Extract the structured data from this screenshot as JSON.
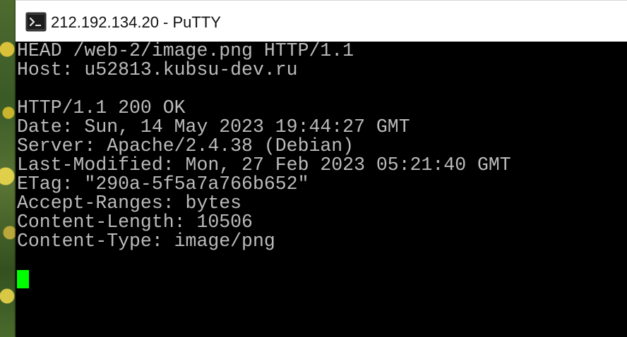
{
  "window": {
    "title": "212.192.134.20 - PuTTY",
    "icon": "putty-terminal-icon"
  },
  "terminal": {
    "lines": [
      "HEAD /web-2/image.png HTTP/1.1",
      "Host: u52813.kubsu-dev.ru",
      "",
      "HTTP/1.1 200 OK",
      "Date: Sun, 14 May 2023 19:44:27 GMT",
      "Server: Apache/2.4.38 (Debian)",
      "Last-Modified: Mon, 27 Feb 2023 05:21:40 GMT",
      "ETag: \"290a-5f5a7a766b652\"",
      "Accept-Ranges: bytes",
      "Content-Length: 10506",
      "Content-Type: image/png",
      "",
      ""
    ],
    "text_color": "#bbbbbb",
    "background_color": "#000000",
    "cursor_color": "#00ff00"
  }
}
